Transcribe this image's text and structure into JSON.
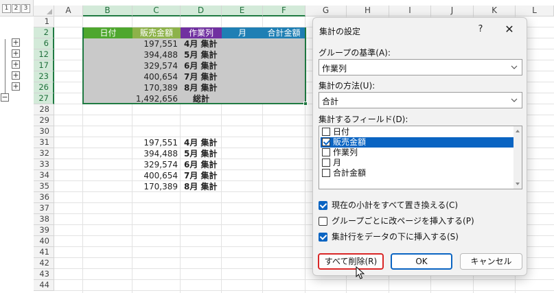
{
  "outline": {
    "level_buttons": [
      "1",
      "2",
      "3"
    ],
    "group_buttons": [
      "+",
      "+",
      "+",
      "+",
      "+",
      "−"
    ]
  },
  "columns": [
    "A",
    "B",
    "C",
    "D",
    "E",
    "F",
    "G",
    "H",
    "I",
    "J",
    "K",
    "L"
  ],
  "rows": [
    "1",
    "2",
    "6",
    "12",
    "17",
    "23",
    "26",
    "27",
    "28",
    "29",
    "30",
    "31",
    "32",
    "33",
    "34",
    "35",
    "36",
    "37",
    "38",
    "39",
    "40",
    "41",
    "42",
    "43",
    "44"
  ],
  "table_header": [
    "日付",
    "販売金額",
    "作業列",
    "月",
    "合計金額"
  ],
  "header_colors": {
    "date": "#4ea72e",
    "sales": "#8db24a",
    "work": "#7030a0",
    "month": "#1f7fb4",
    "total": "#1f7fb4"
  },
  "subtotal_rows": [
    {
      "amount": "197,551",
      "label": "4月 集計"
    },
    {
      "amount": "394,488",
      "label": "5月 集計"
    },
    {
      "amount": "329,574",
      "label": "6月 集計"
    },
    {
      "amount": "400,654",
      "label": "7月 集計"
    },
    {
      "amount": "170,389",
      "label": "8月 集計"
    }
  ],
  "grand_total": {
    "amount": "1,492,656",
    "label": "総計"
  },
  "copied_rows": [
    {
      "amount": "197,551",
      "label": "4月 集計"
    },
    {
      "amount": "394,488",
      "label": "5月 集計"
    },
    {
      "amount": "329,574",
      "label": "6月 集計"
    },
    {
      "amount": "400,654",
      "label": "7月 集計"
    },
    {
      "amount": "170,389",
      "label": "8月 集計"
    }
  ],
  "dialog": {
    "title": "集計の設定",
    "help": "?",
    "close": "✕",
    "group_by_label": "グループの基準(A):",
    "group_by_value": "作業列",
    "function_label": "集計の方法(U):",
    "function_value": "合計",
    "fields_label": "集計するフィールド(D):",
    "fields": [
      {
        "label": "日付",
        "checked": false,
        "selected": false
      },
      {
        "label": "販売金額",
        "checked": true,
        "selected": true
      },
      {
        "label": "作業列",
        "checked": false,
        "selected": false
      },
      {
        "label": "月",
        "checked": false,
        "selected": false
      },
      {
        "label": "合計金額",
        "checked": false,
        "selected": false
      }
    ],
    "options": [
      {
        "label": "現在の小計をすべて置き換える(C)",
        "checked": true
      },
      {
        "label": "グループごとに改ページを挿入する(P)",
        "checked": false
      },
      {
        "label": "集計行をデータの下に挿入する(S)",
        "checked": true
      }
    ],
    "remove_all_label": "すべて削除(R)",
    "ok_label": "OK",
    "cancel_label": "キャンセル"
  },
  "icons": {
    "cursor": "mouse-pointer-icon",
    "chevron": "chevron-down-icon"
  }
}
